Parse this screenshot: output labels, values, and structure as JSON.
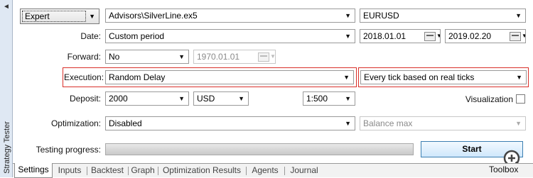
{
  "panel_title": "Strategy Tester",
  "collapse_arrow": "◄",
  "program_type": "Expert",
  "expert_path": "Advisors\\SilverLine.ex5",
  "symbol": "EURUSD",
  "date": {
    "label": "Date:",
    "mode": "Custom period",
    "from": "2018.01.01",
    "to": "2019.02.20"
  },
  "forward": {
    "label": "Forward:",
    "mode": "No",
    "date": "1970.01.01"
  },
  "execution": {
    "label": "Execution:",
    "delay": "Random Delay",
    "model": "Every tick based on real ticks"
  },
  "deposit": {
    "label": "Deposit:",
    "amount": "2000",
    "currency": "USD",
    "leverage": "1:500"
  },
  "visualization_label": "Visualization",
  "optimization": {
    "label": "Optimization:",
    "mode": "Disabled",
    "criterion": "Balance max"
  },
  "progress": {
    "label": "Testing progress:",
    "value": 0
  },
  "start_label": "Start",
  "toolbox_label": "Toolbox",
  "tabs": [
    {
      "label": "Settings",
      "active": true
    },
    {
      "label": "Inputs"
    },
    {
      "label": "Backtest"
    },
    {
      "label": "Graph"
    },
    {
      "label": "Optimization Results"
    },
    {
      "label": "Agents"
    },
    {
      "label": "Journal"
    }
  ],
  "colors": {
    "highlight_border": "#d9302a",
    "start_border": "#3c7fb1",
    "strip_bg": "#dfe8f3"
  },
  "icons": [
    "collapse-arrow-icon",
    "dropdown-caret-icon",
    "calendar-icon",
    "zoom-in-icon"
  ]
}
